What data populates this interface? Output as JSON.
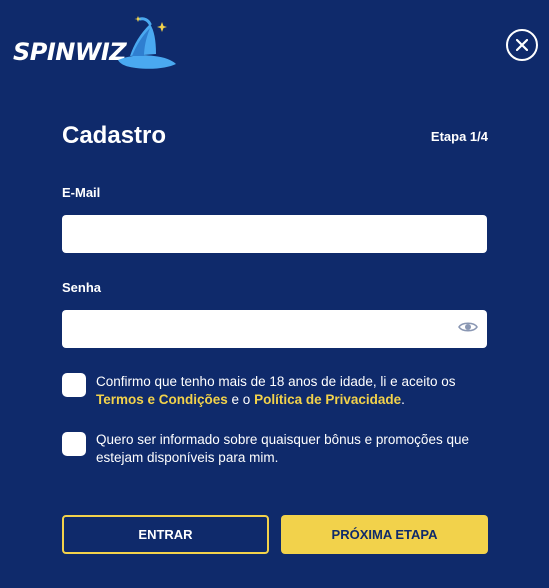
{
  "brand": {
    "logo_text": "SPINWIZ",
    "hat_color": "#4aa9f0",
    "accent": "#f2d24b",
    "background": "#0f2a6b"
  },
  "header": {
    "title": "Cadastro",
    "step": "Etapa 1/4"
  },
  "form": {
    "email_label": "E-Mail",
    "email_value": "",
    "password_label": "Senha",
    "password_value": ""
  },
  "consents": {
    "age": {
      "text_before": "Confirmo que tenho mais de 18 anos de idade, li e aceito os ",
      "terms_link": "Termos e Condições",
      "middle": " e o ",
      "privacy_link": "Política de Privacidade",
      "text_after": ".",
      "checked": false
    },
    "marketing": {
      "text": "Quero ser informado sobre quaisquer bônus e promoções que estejam disponíveis para mim.",
      "checked": false
    }
  },
  "actions": {
    "login_label": "ENTRAR",
    "next_label": "PRÓXIMA ETAPA"
  },
  "icons": {
    "close": "close-icon",
    "eye": "eye-icon",
    "logo": "wizard-hat-logo"
  }
}
